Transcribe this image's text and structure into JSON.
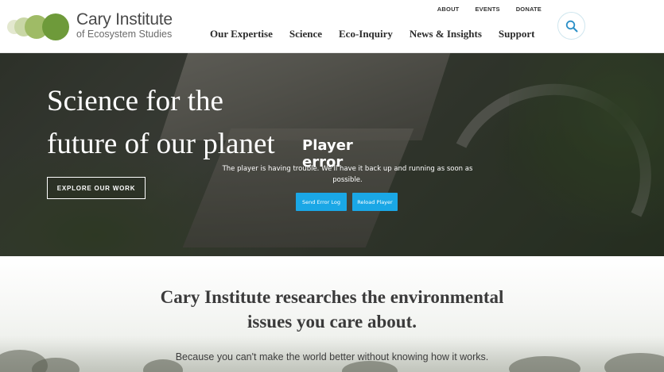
{
  "logo": {
    "title": "Cary Institute",
    "subtitle": "of Ecosystem Studies"
  },
  "utility_nav": [
    {
      "label": "ABOUT"
    },
    {
      "label": "EVENTS"
    },
    {
      "label": "DONATE"
    }
  ],
  "main_nav": [
    {
      "label": "Our Expertise"
    },
    {
      "label": "Science"
    },
    {
      "label": "Eco-Inquiry"
    },
    {
      "label": "News & Insights"
    },
    {
      "label": "Support"
    }
  ],
  "search": {
    "icon": "search-icon"
  },
  "hero": {
    "headline_line1": "Science for the",
    "headline_line2": "future of our planet",
    "cta_label": "EXPLORE OUR WORK"
  },
  "player_error": {
    "title": "Player error",
    "message": "The player is having trouble. We'll have it back up and running as soon as possible.",
    "send_log_label": "Send Error Log",
    "reload_label": "Reload Player"
  },
  "intro": {
    "heading_line1": "Cary Institute researches the environmental",
    "heading_line2": "issues you care about.",
    "subheading": "Because you can't make the world better without knowing how it works."
  },
  "colors": {
    "logo_green_dark": "#6e9a3a",
    "logo_green_light": "#c9d7a6",
    "search_blue": "#2a8fc7",
    "player_button_blue": "#1aa7e6"
  }
}
